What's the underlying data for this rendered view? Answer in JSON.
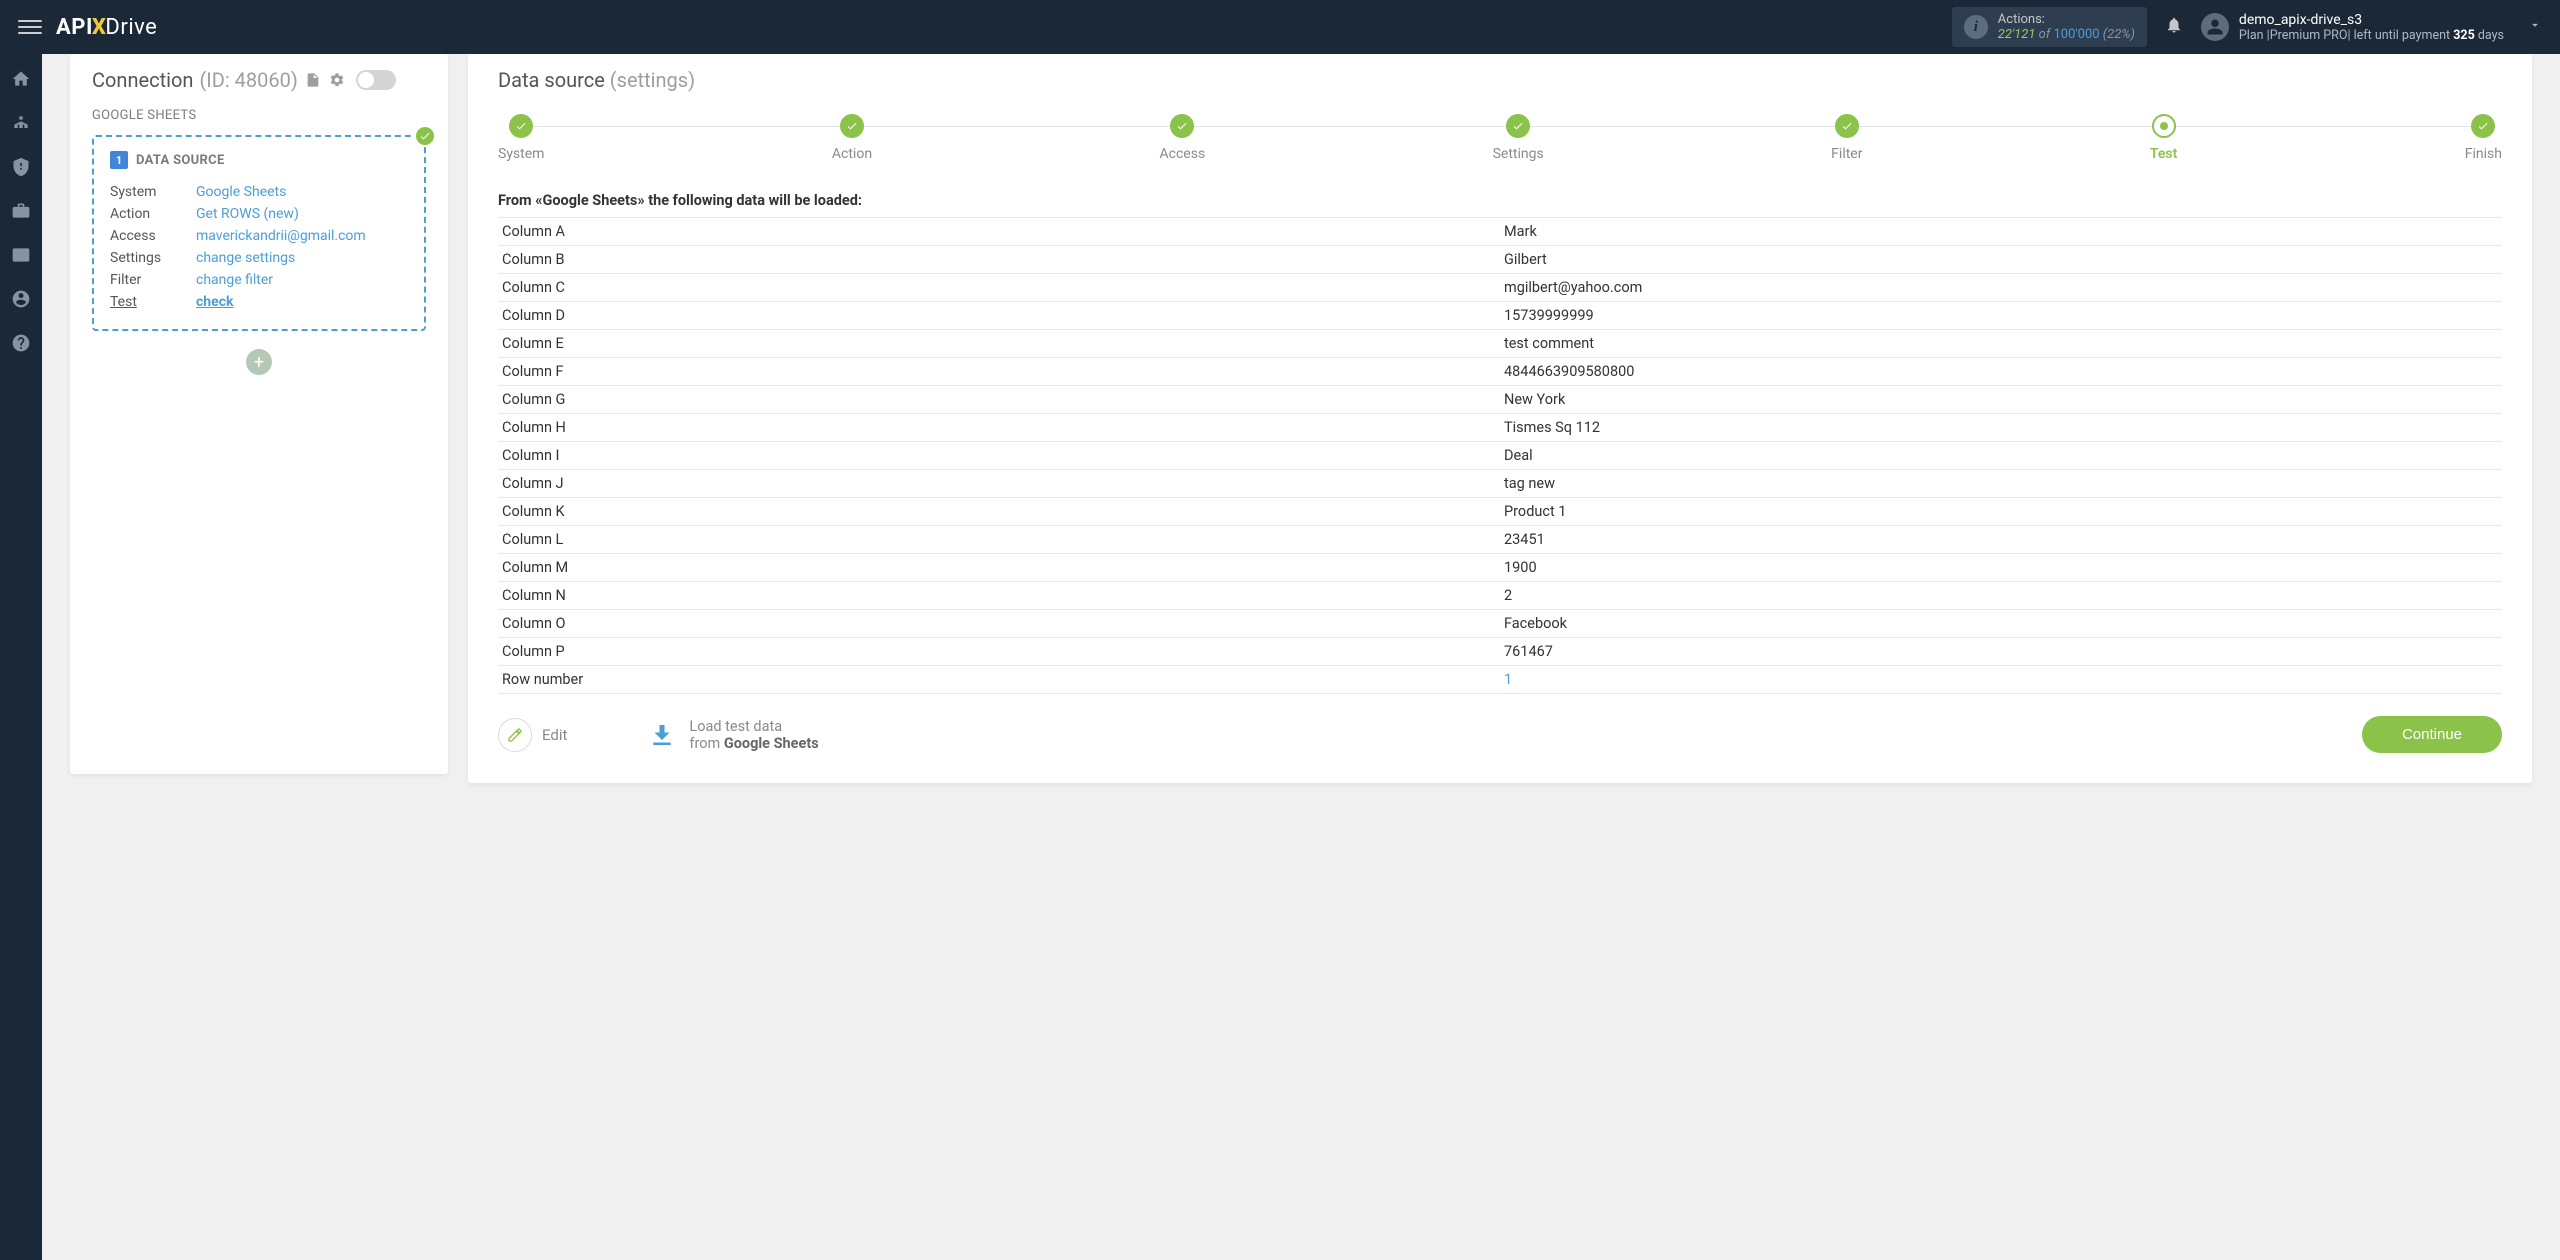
{
  "header": {
    "actions_label": "Actions:",
    "actions_used": "22'121",
    "actions_of": "of",
    "actions_total": "100'000",
    "actions_pct": "(22%)",
    "username": "demo_apix-drive_s3",
    "plan_prefix": "Plan |",
    "plan_name": "Premium PRO",
    "plan_suffix": "| left until payment",
    "plan_days": "325",
    "plan_days_unit": "days"
  },
  "left": {
    "title_word": "Connection",
    "title_id": "(ID: 48060)",
    "subtitle": "GOOGLE SHEETS",
    "ds": {
      "num": "1",
      "head": "DATA SOURCE",
      "rows": {
        "system_k": "System",
        "system_v": "Google Sheets",
        "action_k": "Action",
        "action_v": "Get ROWS (new)",
        "access_k": "Access",
        "access_v": "maverickandrii@gmail.com",
        "settings_k": "Settings",
        "settings_v": "change settings",
        "filter_k": "Filter",
        "filter_v": "change filter",
        "test_k": "Test",
        "test_v": "check"
      }
    }
  },
  "right": {
    "title_word": "Data source",
    "title_muted": "(settings)",
    "steps": {
      "system": "System",
      "action": "Action",
      "access": "Access",
      "settings": "Settings",
      "filter": "Filter",
      "test": "Test",
      "finish": "Finish"
    },
    "from_text": "From «Google Sheets» the following data will be loaded:",
    "rows": [
      {
        "k": "Column A",
        "v": "Mark"
      },
      {
        "k": "Column B",
        "v": "Gilbert"
      },
      {
        "k": "Column C",
        "v": "mgilbert@yahoo.com"
      },
      {
        "k": "Column D",
        "v": "15739999999"
      },
      {
        "k": "Column E",
        "v": "test comment"
      },
      {
        "k": "Column F",
        "v": "4844663909580800"
      },
      {
        "k": "Column G",
        "v": "New York"
      },
      {
        "k": "Column H",
        "v": "Tismes Sq 112"
      },
      {
        "k": "Column I",
        "v": "Deal"
      },
      {
        "k": "Column J",
        "v": "tag new"
      },
      {
        "k": "Column K",
        "v": "Product 1"
      },
      {
        "k": "Column L",
        "v": "23451"
      },
      {
        "k": "Column M",
        "v": "1900"
      },
      {
        "k": "Column N",
        "v": "2"
      },
      {
        "k": "Column O",
        "v": "Facebook"
      },
      {
        "k": "Column P",
        "v": "761467"
      },
      {
        "k": "Row number",
        "v": "1",
        "link": true
      }
    ],
    "footer": {
      "edit": "Edit",
      "load1": "Load test data",
      "load2_prefix": "from ",
      "load2_bold": "Google Sheets",
      "continue": "Continue"
    }
  }
}
